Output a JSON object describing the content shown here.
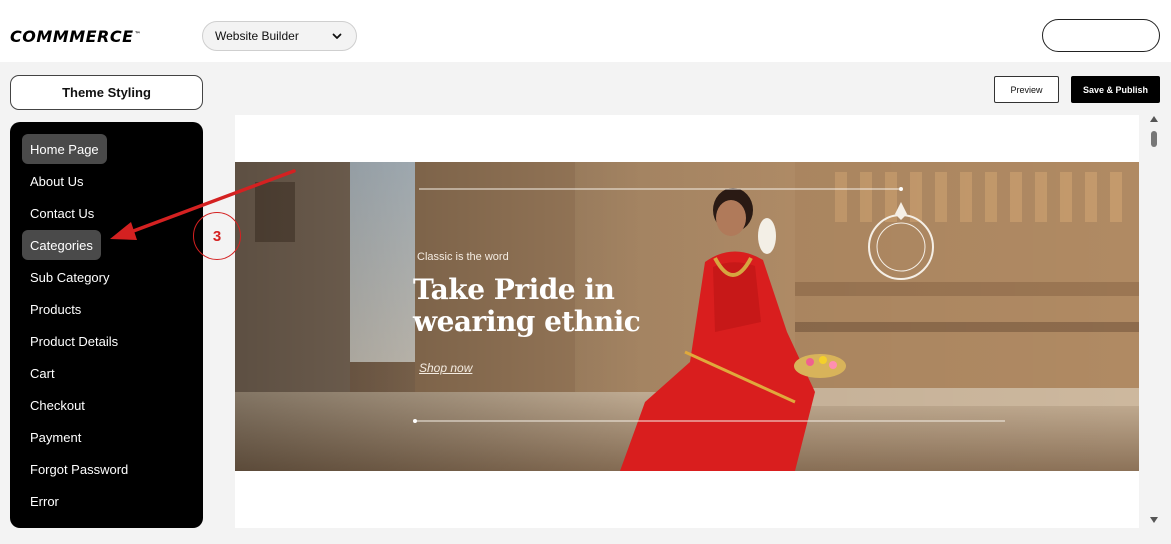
{
  "header": {
    "logo_text": "COMMMERCE",
    "logo_mark": "™",
    "builder_select": {
      "value": "Website Builder",
      "icon": "chevron-down-icon"
    }
  },
  "theme_styling_label": "Theme Styling",
  "sidebar": {
    "items": [
      {
        "label": "Home Page",
        "active": true
      },
      {
        "label": "About Us",
        "active": false
      },
      {
        "label": "Contact Us",
        "active": false
      },
      {
        "label": "Categories",
        "active": false,
        "highlighted": true
      },
      {
        "label": "Sub Category",
        "active": false
      },
      {
        "label": "Products",
        "active": false
      },
      {
        "label": "Product Details",
        "active": false
      },
      {
        "label": "Cart",
        "active": false
      },
      {
        "label": "Checkout",
        "active": false
      },
      {
        "label": "Payment",
        "active": false
      },
      {
        "label": "Forgot Password",
        "active": false
      },
      {
        "label": "Error",
        "active": false
      }
    ]
  },
  "toolbar": {
    "preview_label": "Preview",
    "publish_label": "Save & Publish"
  },
  "banner": {
    "eyebrow": "Classic is the word",
    "headline": "Take Pride in wearing ethnic",
    "cta": "Shop now"
  },
  "annotation": {
    "step_number": "3",
    "color": "#d42121"
  },
  "colors": {
    "sidebar_bg": "#000000",
    "active_item_bg": "#4a4a4a",
    "page_bg": "#f3f3f3",
    "primary_button": "#000000"
  }
}
